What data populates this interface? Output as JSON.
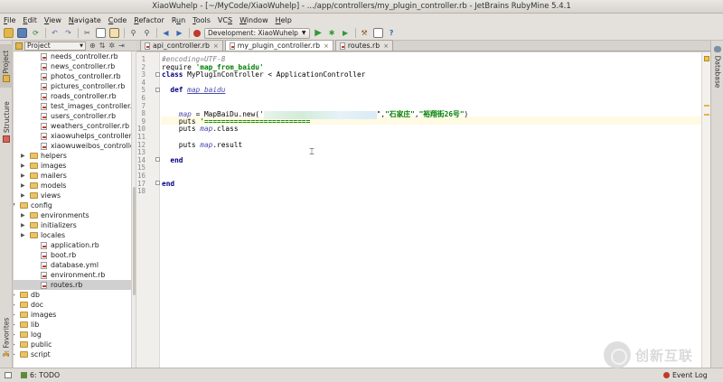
{
  "window": {
    "title": "XiaoWuhelp - [~/MyCode/XiaoWuhelp] - .../app/controllers/my_plugin_controller.rb - JetBrains RubyMine 5.4.1"
  },
  "menu": [
    {
      "pre": "",
      "u": "F",
      "post": "ile"
    },
    {
      "pre": "",
      "u": "E",
      "post": "dit"
    },
    {
      "pre": "",
      "u": "V",
      "post": "iew"
    },
    {
      "pre": "",
      "u": "N",
      "post": "avigate"
    },
    {
      "pre": "",
      "u": "C",
      "post": "ode"
    },
    {
      "pre": "",
      "u": "R",
      "post": "efactor"
    },
    {
      "pre": "R",
      "u": "u",
      "post": "n"
    },
    {
      "pre": "",
      "u": "T",
      "post": "ools"
    },
    {
      "pre": "VC",
      "u": "S",
      "post": ""
    },
    {
      "pre": "",
      "u": "W",
      "post": "indow"
    },
    {
      "pre": "",
      "u": "H",
      "post": "elp"
    }
  ],
  "toolbar": {
    "run_config": "Development: XiaoWuhelp"
  },
  "left_strip": {
    "project": "1: Project",
    "structure": "7: Structure",
    "favorites": "2: Favorites"
  },
  "right_strip": {
    "database": "Database"
  },
  "project_panel": {
    "view_select": "Project",
    "tree": [
      {
        "label": "needs_controller.rb",
        "kind": "file",
        "indent": 3
      },
      {
        "label": "news_controller.rb",
        "kind": "file",
        "indent": 3
      },
      {
        "label": "photos_controller.rb",
        "kind": "file",
        "indent": 3
      },
      {
        "label": "pictures_controller.rb",
        "kind": "file",
        "indent": 3
      },
      {
        "label": "roads_controller.rb",
        "kind": "file",
        "indent": 3
      },
      {
        "label": "test_images_controller.rb",
        "kind": "file",
        "indent": 3
      },
      {
        "label": "users_controller.rb",
        "kind": "file",
        "indent": 3
      },
      {
        "label": "weathers_controller.rb",
        "kind": "file",
        "indent": 3
      },
      {
        "label": "xiaowuhelps_controller.rb",
        "kind": "file",
        "indent": 3
      },
      {
        "label": "xiaowuweibos_controller.rb",
        "kind": "file",
        "indent": 3
      },
      {
        "label": "helpers",
        "kind": "dir",
        "indent": 2,
        "open": false
      },
      {
        "label": "images",
        "kind": "dir",
        "indent": 2,
        "open": false
      },
      {
        "label": "mailers",
        "kind": "dir",
        "indent": 2,
        "open": false
      },
      {
        "label": "models",
        "kind": "dir",
        "indent": 2,
        "open": false
      },
      {
        "label": "views",
        "kind": "dir",
        "indent": 2,
        "open": false
      },
      {
        "label": "config",
        "kind": "dir",
        "indent": 1,
        "open": true
      },
      {
        "label": "environments",
        "kind": "dir",
        "indent": 2,
        "open": false
      },
      {
        "label": "initializers",
        "kind": "dir",
        "indent": 2,
        "open": false
      },
      {
        "label": "locales",
        "kind": "dir",
        "indent": 2,
        "open": false
      },
      {
        "label": "application.rb",
        "kind": "file",
        "indent": 3
      },
      {
        "label": "boot.rb",
        "kind": "file",
        "indent": 3
      },
      {
        "label": "database.yml",
        "kind": "file",
        "indent": 3
      },
      {
        "label": "environment.rb",
        "kind": "file",
        "indent": 3
      },
      {
        "label": "routes.rb",
        "kind": "file",
        "indent": 3,
        "selected": true
      },
      {
        "label": "db",
        "kind": "dir",
        "indent": 1,
        "open": false
      },
      {
        "label": "doc",
        "kind": "dir",
        "indent": 1,
        "open": false
      },
      {
        "label": "images",
        "kind": "dir",
        "indent": 1,
        "open": false
      },
      {
        "label": "lib",
        "kind": "dir",
        "indent": 1,
        "open": false
      },
      {
        "label": "log",
        "kind": "dir",
        "indent": 1,
        "open": false
      },
      {
        "label": "public",
        "kind": "dir",
        "indent": 1,
        "open": false
      },
      {
        "label": "script",
        "kind": "dir",
        "indent": 1,
        "open": false
      }
    ]
  },
  "tabs": [
    {
      "label": "api_controller.rb",
      "active": false
    },
    {
      "label": "my_plugin_controller.rb",
      "active": true
    },
    {
      "label": "routes.rb",
      "active": false
    }
  ],
  "editor": {
    "current_line": 9,
    "lines": [
      [
        {
          "t": "#encoding=UTF-8",
          "c": "cm"
        }
      ],
      [
        {
          "t": "require ",
          "c": ""
        },
        {
          "t": "'map_from_baidu'",
          "c": "str"
        }
      ],
      [
        {
          "t": "class",
          "c": "kw"
        },
        {
          "t": " MyPluginController < ApplicationController",
          "c": ""
        }
      ],
      [],
      [
        {
          "t": "  def ",
          "c": "kw"
        },
        {
          "t": "map_baidu",
          "c": "meth"
        }
      ],
      [],
      [],
      [
        {
          "t": "    ",
          "c": ""
        },
        {
          "t": "map",
          "c": "var"
        },
        {
          "t": " = MapBaiDu.new('",
          "c": ""
        },
        {
          "t": "",
          "c": "blur"
        },
        {
          "t": "\",",
          "c": ""
        },
        {
          "t": "\"石家庄\"",
          "c": "str"
        },
        {
          "t": ",",
          "c": ""
        },
        {
          "t": "\"裕翔街26号\"",
          "c": "str"
        },
        {
          "t": ")",
          "c": ""
        }
      ],
      [
        {
          "t": "    puts ",
          "c": ""
        },
        {
          "t": "'=========================",
          "c": "str"
        }
      ],
      [
        {
          "t": "    puts ",
          "c": ""
        },
        {
          "t": "map",
          "c": "var"
        },
        {
          "t": ".class",
          "c": ""
        }
      ],
      [],
      [
        {
          "t": "    puts ",
          "c": ""
        },
        {
          "t": "map",
          "c": "var"
        },
        {
          "t": ".result",
          "c": ""
        }
      ],
      [],
      [
        {
          "t": "  end",
          "c": "kw"
        }
      ],
      [],
      [],
      [
        {
          "t": "end",
          "c": "kw"
        }
      ],
      []
    ]
  },
  "status": {
    "todo": "6: TODO",
    "event_log": "Event Log"
  },
  "watermark": {
    "text": "创新互联"
  }
}
